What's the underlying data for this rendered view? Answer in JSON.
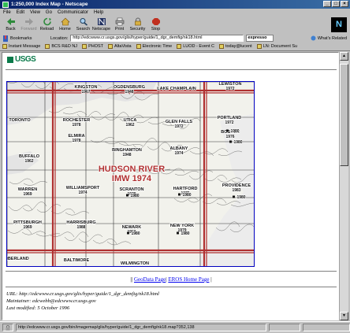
{
  "window": {
    "title": "1:250,000 Index Map - Netscape"
  },
  "menu": [
    "File",
    "Edit",
    "View",
    "Go",
    "Communicator",
    "Help"
  ],
  "toolbar": {
    "back": "Back",
    "forward": "Forward",
    "reload": "Reload",
    "home": "Home",
    "search": "Search",
    "netscape": "Netscape",
    "print": "Print",
    "security": "Security",
    "stop": "Stop"
  },
  "location": {
    "bookmarks": "Bookmarks",
    "label": "Location:",
    "url": "http://edcwww.cr.usgs.gov/glis/hyper/guide/1_dgr_demfig/nk18.html",
    "expresso": "expresso",
    "related": "What's Related"
  },
  "personal_bar": [
    "Instant Message",
    "BCS R&D NJ",
    "PHOST",
    "AltaVista",
    "Electronic Time",
    "LUOD - Event C",
    "today@lucent",
    "LN: Document Su"
  ],
  "page": {
    "logo": "USGS",
    "map": {
      "title_line1": "HUDSON RIVER",
      "title_line2": "IMW 1974",
      "quads": [
        {
          "name": "KINGSTON",
          "year": "1967"
        },
        {
          "name": "OGDENSBURG",
          "year": "1948"
        },
        {
          "name": "LAKE CHAMPLAIN",
          "year": ""
        },
        {
          "name": "LEWISTON",
          "year": "1972"
        },
        {
          "name": "TORONTO",
          "year": ""
        },
        {
          "name": "ROCHESTER",
          "year": "1978"
        },
        {
          "name": "UTICA",
          "year": "1962"
        },
        {
          "name": "GLEN FALLS",
          "year": "1972"
        },
        {
          "name": "PORTLAND",
          "year": "1972"
        },
        {
          "name": "BUFFALO",
          "year": "1962"
        },
        {
          "name": "ELMIRA",
          "year": "1978"
        },
        {
          "name": "BINGHAMTON",
          "year": "1948"
        },
        {
          "name": "ALBANY",
          "year": "1974"
        },
        {
          "name": "BOSTON",
          "year": "1976"
        },
        {
          "name": "WARREN",
          "year": "1969"
        },
        {
          "name": "WILLIAMSPORT",
          "year": "1974"
        },
        {
          "name": "SCRANTON",
          "year": "1978"
        },
        {
          "name": "HARTFORD",
          "year": "1975"
        },
        {
          "name": "PROVIDENCE",
          "year": "1983"
        },
        {
          "name": "PITTSBURGH",
          "year": "1969"
        },
        {
          "name": "HARRISBURG",
          "year": "1988"
        },
        {
          "name": "NEWARK",
          "year": "1959"
        },
        {
          "name": "NEW YORK",
          "year": "1979"
        },
        {
          "name": "CUMBERLAND",
          "year": ""
        },
        {
          "name": "BALTIMORE",
          "year": ""
        },
        {
          "name": "WILMINGTON",
          "year": ""
        }
      ],
      "marker_years": [
        "1980",
        "1980",
        "1980",
        "1980",
        "1980",
        "1980",
        "1980"
      ]
    },
    "links": {
      "sep_left": "||",
      "geodata": "GeoData Page",
      "sep_mid": "|",
      "eros": "EROS Home Page",
      "sep_right": "|"
    },
    "footer": {
      "url": "URL: http://edcwww.cr.usgs.gov/glis/hyper/guide/1_dgr_demfig/nk18.html",
      "maintainer": "Maintainer: edcwebb@edcwww.cr.usgs.gov",
      "modified": "Last modified: 5 October 1996"
    }
  },
  "status": {
    "text": "http://edcwww.cr.usgs.gov/bin/imagemap/glis/hyper/guide/1_dgr_demfig/nk18.map?352,138"
  },
  "colors": {
    "title_start": "#0a246a",
    "title_end": "#3a6ea5",
    "usgs_green": "#0a7a4a",
    "map_border": "#0000c0",
    "map_grid_red": "#b03030",
    "link": "#0000ee"
  }
}
